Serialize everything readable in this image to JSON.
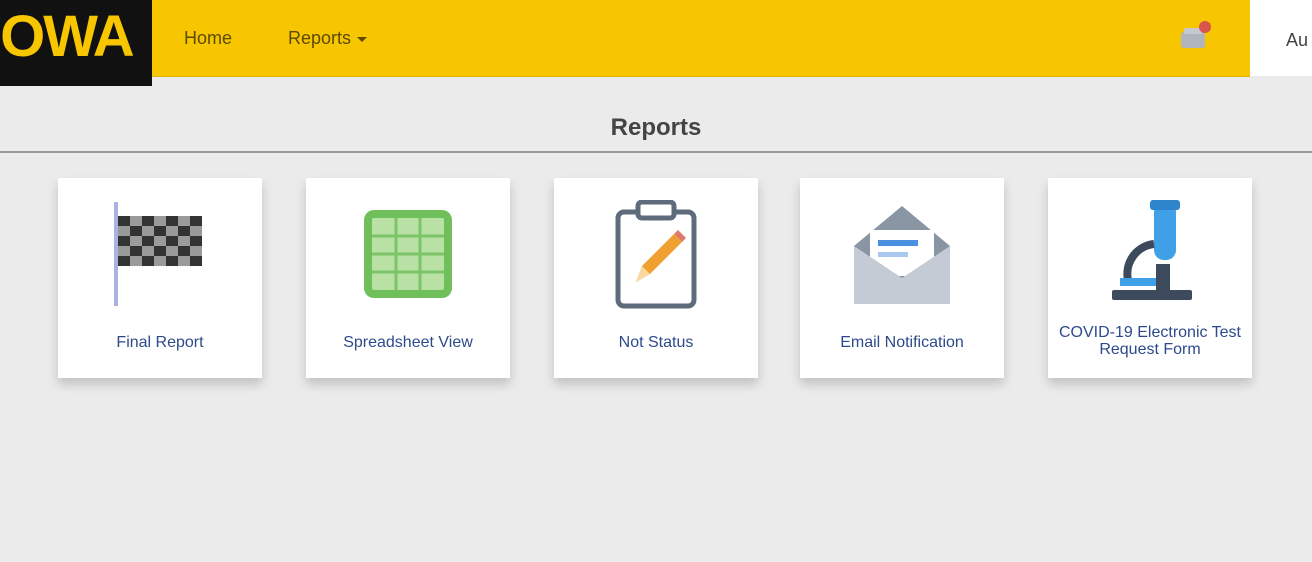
{
  "header": {
    "logo_text": "IOWA",
    "nav": [
      {
        "label": "Home"
      },
      {
        "label": "Reports"
      }
    ],
    "user_text": "Au"
  },
  "page": {
    "title": "Reports"
  },
  "tiles": [
    {
      "label": "Final Report",
      "icon": "checkered-flag-icon"
    },
    {
      "label": "Spreadsheet View",
      "icon": "spreadsheet-icon"
    },
    {
      "label": "Not Status",
      "icon": "clipboard-pencil-icon"
    },
    {
      "label": "Email Notification",
      "icon": "envelope-icon"
    },
    {
      "label": "COVID-19 Electronic Test Request Form",
      "icon": "microscope-icon"
    }
  ],
  "colors": {
    "header_bg": "#f7c600",
    "logo_bg": "#111111",
    "page_bg": "#ebebeb",
    "tile_label": "#2d4a8c"
  }
}
